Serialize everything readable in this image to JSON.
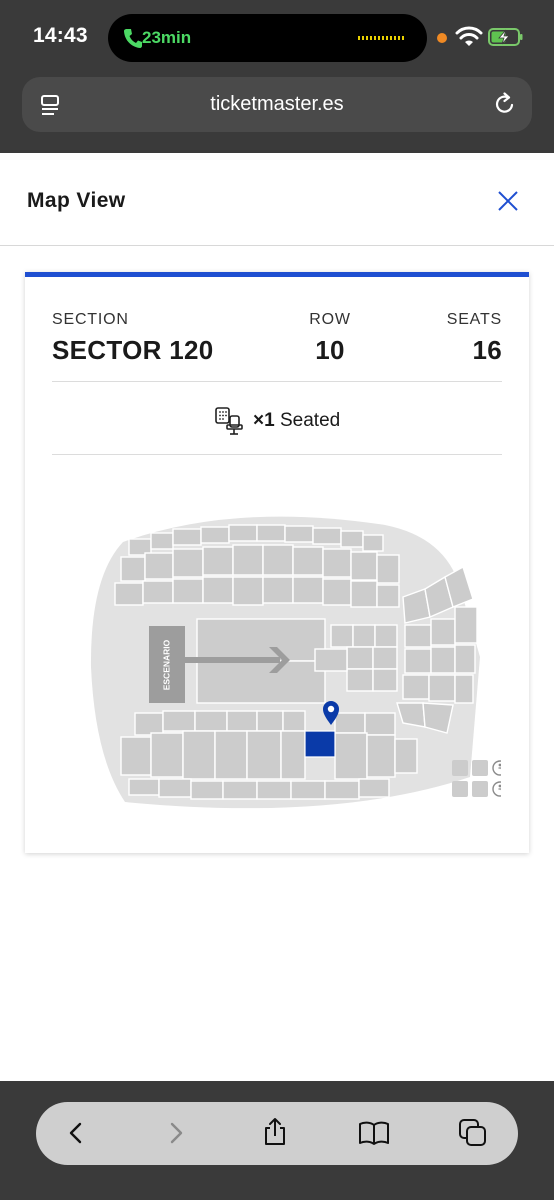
{
  "status_bar": {
    "time": "14:43",
    "call_duration": "23min",
    "icons": [
      "phone-icon",
      "wifi-icon",
      "battery-charging-icon"
    ]
  },
  "browser": {
    "url": "ticketmaster.es",
    "icons": [
      "reader-menu-icon",
      "reload-icon"
    ]
  },
  "modal": {
    "title": "Map View",
    "close_icon": "close-icon",
    "accent_color": "#1f4fd1"
  },
  "ticket": {
    "section_label": "SECTION",
    "section_value": "SECTOR 120",
    "row_label": "ROW",
    "row_value": "10",
    "seats_label": "SEATS",
    "seats_value": "16",
    "quantity": "×1",
    "seat_type": "Seated"
  },
  "venue_map": {
    "stage_label": "ESCENARIO",
    "selected_color": "#0a3aa8",
    "section_color": "#cccccc",
    "background_color": "#e2e2e2"
  },
  "toolbar": {
    "items": [
      "back-icon",
      "forward-icon",
      "share-icon",
      "bookmarks-icon",
      "tabs-icon"
    ]
  }
}
